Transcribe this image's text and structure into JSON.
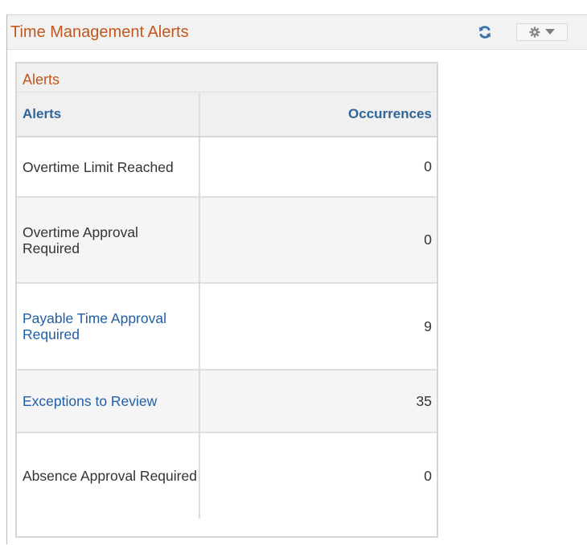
{
  "pagelet": {
    "title": "Time Management Alerts",
    "title_color": "#c2571d",
    "icons": {
      "refresh": "refresh-icon",
      "gear": "gear-icon",
      "dropdown": "caret-down-icon"
    }
  },
  "grid": {
    "caption": "Alerts",
    "columns": {
      "alert": "Alerts",
      "occurrences": "Occurrences"
    },
    "link_color": "#1f5fa8",
    "rows": [
      {
        "alert": "Overtime Limit Reached",
        "occurrences": "0",
        "is_link": false
      },
      {
        "alert": "Overtime Approval Required",
        "occurrences": "0",
        "is_link": false
      },
      {
        "alert": "Payable Time Approval Required",
        "occurrences": "9",
        "is_link": true
      },
      {
        "alert": "Exceptions to Review",
        "occurrences": "35",
        "is_link": true
      },
      {
        "alert": "Absence Approval Required",
        "occurrences": "0",
        "is_link": false
      }
    ]
  }
}
